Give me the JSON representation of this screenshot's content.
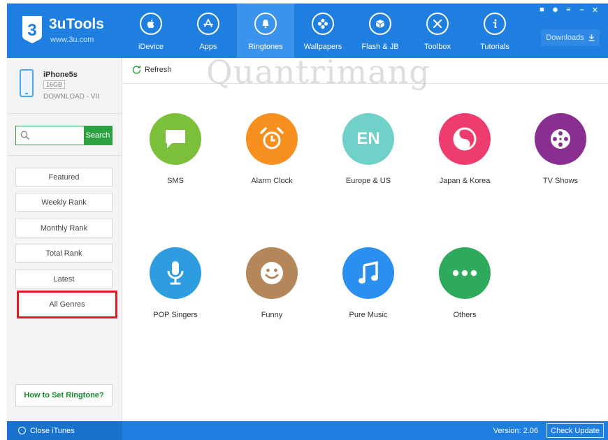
{
  "app": {
    "name": "3uTools",
    "url": "www.3u.com",
    "brand_color": "#1f7fe0"
  },
  "nav": [
    {
      "label": "iDevice",
      "icon": "apple-icon"
    },
    {
      "label": "Apps",
      "icon": "app-store-icon"
    },
    {
      "label": "Ringtones",
      "icon": "bell-icon",
      "active": true
    },
    {
      "label": "Wallpapers",
      "icon": "flower-icon"
    },
    {
      "label": "Flash & JB",
      "icon": "box-icon"
    },
    {
      "label": "Toolbox",
      "icon": "tools-icon"
    },
    {
      "label": "Tutorials",
      "icon": "info-icon"
    }
  ],
  "window_controls": [
    "shirt-icon",
    "gear-icon",
    "menu-icon",
    "minimize-icon",
    "close-icon"
  ],
  "downloads_label": "Downloads",
  "device": {
    "name": "iPhone5s",
    "capacity": "16GB",
    "status": "DOWNLOAD - VII"
  },
  "search": {
    "placeholder": "",
    "button_label": "Search"
  },
  "sidebar": {
    "items": [
      {
        "label": "Featured"
      },
      {
        "label": "Weekly Rank"
      },
      {
        "label": "Monthly Rank"
      },
      {
        "label": "Total Rank"
      },
      {
        "label": "Latest"
      },
      {
        "label": "All Genres",
        "highlighted": true
      }
    ],
    "howto_label": "How to Set Ringtone?"
  },
  "toolbar": {
    "refresh_label": "Refresh",
    "watermark": "Quantrimang"
  },
  "categories": [
    {
      "label": "SMS",
      "color": "#7cbf3a",
      "icon": "chat-icon"
    },
    {
      "label": "Alarm Clock",
      "color": "#f7901e",
      "icon": "alarm-clock-icon"
    },
    {
      "label": "Europe & US",
      "color": "#6fd1c7",
      "icon": "en-text-icon",
      "icon_text": "EN"
    },
    {
      "label": "Japan & Korea",
      "color": "#ee3c6e",
      "icon": "yin-yang-icon"
    },
    {
      "label": "TV Shows",
      "color": "#8a2e91",
      "icon": "film-reel-icon"
    },
    {
      "label": "POP Singers",
      "color": "#2e9de0",
      "icon": "microphone-icon"
    },
    {
      "label": "Funny",
      "color": "#b5865a",
      "icon": "smiley-icon"
    },
    {
      "label": "Pure Music",
      "color": "#2b8ff0",
      "icon": "music-note-icon"
    },
    {
      "label": "Others",
      "color": "#2eaa5c",
      "icon": "more-dots-icon"
    }
  ],
  "statusbar": {
    "close_itunes_label": "Close iTunes",
    "version": "Version: 2.06",
    "check_update_label": "Check Update"
  }
}
